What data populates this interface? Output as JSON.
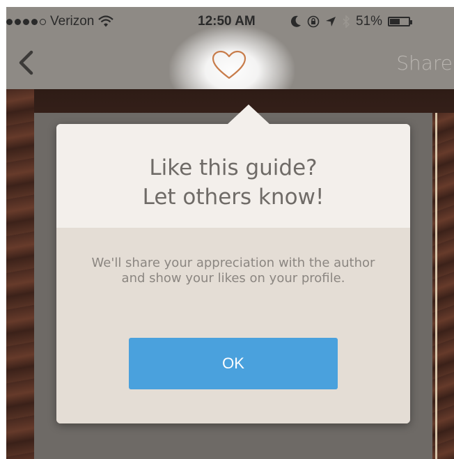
{
  "status_bar": {
    "carrier": "Verizon",
    "time": "12:50 AM",
    "battery_percent": "51%",
    "battery_level": 0.51,
    "signal_bars_filled": 4,
    "signal_bars_total": 5,
    "icons": [
      "wifi-icon",
      "moon-icon",
      "orientation-lock-icon",
      "location-arrow-icon",
      "bluetooth-icon",
      "battery-icon"
    ]
  },
  "nav": {
    "back_icon": "chevron-left-icon",
    "like_icon": "heart-icon",
    "share_label": "Share"
  },
  "popover": {
    "title_line1": "Like this guide?",
    "title_line2": "Let others know!",
    "message": "We'll share your appreciation with the author and show your likes on your profile.",
    "ok_label": "OK"
  },
  "colors": {
    "accent": "#4aa1dd",
    "heart": "#c87c4a",
    "popover_header": "#f3efeb",
    "popover_body": "#e4ddd5"
  }
}
